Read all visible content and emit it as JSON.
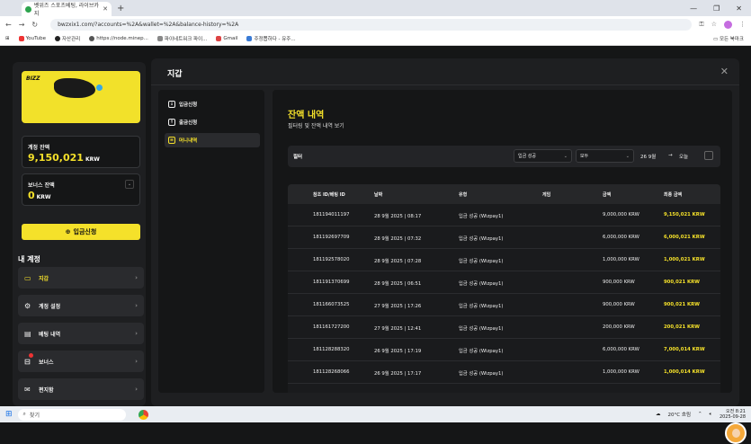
{
  "browser": {
    "tab_title": "벳위즈 스포츠베팅, 라이브카지",
    "url": "bwzxix1.com/?accounts=%2A&wallet=%2A&balance-history=%2A",
    "bookmarks": [
      "YouTube",
      "자산관리",
      "https://node.minep...",
      "파이네트워크 파이...",
      "Gmail",
      "주정뽑하다 - 유주..."
    ],
    "all_bookmarks": "모든 북마크"
  },
  "sidebar": {
    "promo_brand": "BIZZ",
    "balance_label": "계정 잔액",
    "balance_value": "9,150,021",
    "balance_unit": "KRW",
    "bonus_label": "보너스 잔액",
    "bonus_value": "0",
    "bonus_unit": "KRW",
    "deposit_button": "입금신청",
    "section_title": "내 계정",
    "items": [
      {
        "label": "지갑",
        "icon": "wallet-icon"
      },
      {
        "label": "계정 설정",
        "icon": "gear-icon"
      },
      {
        "label": "베팅 내역",
        "icon": "receipt-icon"
      },
      {
        "label": "보너스",
        "icon": "gift-icon"
      },
      {
        "label": "편지함",
        "icon": "mail-icon"
      }
    ]
  },
  "modal": {
    "title": "지갑",
    "subnav": [
      {
        "label": "입금신청",
        "icon": "deposit-icon"
      },
      {
        "label": "출금신청",
        "icon": "withdraw-icon"
      },
      {
        "label": "머니내역",
        "icon": "history-icon"
      }
    ],
    "content_title": "잔액 내역",
    "content_subtitle": "필터링 및 잔액 내역 보기",
    "filter": {
      "label": "필터",
      "type_value": "입금 성공",
      "scope_value": "모두",
      "date_from": "26 9월",
      "arrow": "→",
      "date_to": "오늘"
    },
    "table": {
      "headers": [
        "참조 ID/베팅 ID",
        "날짜",
        "유형",
        "게임",
        "금액",
        "최종 금액"
      ],
      "rows": [
        [
          "181194011197",
          "28 9월 2025 | 08:17",
          "입금 성공 (Wizpay1)",
          "",
          "9,000,000 KRW",
          "9,150,021 KRW"
        ],
        [
          "181192697709",
          "28 9월 2025 | 07:32",
          "입금 성공 (Wizpay1)",
          "",
          "6,000,000 KRW",
          "6,000,021 KRW"
        ],
        [
          "181192578020",
          "28 9월 2025 | 07:28",
          "입금 성공 (Wizpay1)",
          "",
          "1,000,000 KRW",
          "1,000,021 KRW"
        ],
        [
          "181191370699",
          "28 9월 2025 | 06:51",
          "입금 성공 (Wizpay1)",
          "",
          "900,000 KRW",
          "900,021 KRW"
        ],
        [
          "181166073525",
          "27 9월 2025 | 17:26",
          "입금 성공 (Wizpay1)",
          "",
          "900,000 KRW",
          "900,021 KRW"
        ],
        [
          "181161727200",
          "27 9월 2025 | 12:41",
          "입금 성공 (Wizpay1)",
          "",
          "200,000 KRW",
          "200,021 KRW"
        ],
        [
          "181128288320",
          "26 9월 2025 | 17:19",
          "입금 성공 (Wizpay1)",
          "",
          "6,000,000 KRW",
          "7,000,014 KRW"
        ],
        [
          "181128268066",
          "26 9월 2025 | 17:17",
          "입금 성공 (Wizpay1)",
          "",
          "1,000,000 KRW",
          "1,000,014 KRW"
        ]
      ]
    }
  },
  "taskbar": {
    "search_placeholder": "찾기",
    "weather": "20°C 흐림",
    "time": "오전 8:21",
    "date": "2025-09-28"
  },
  "colors": {
    "accent": "#f5e12a",
    "background": "#151617",
    "panel": "#1e1f21"
  }
}
